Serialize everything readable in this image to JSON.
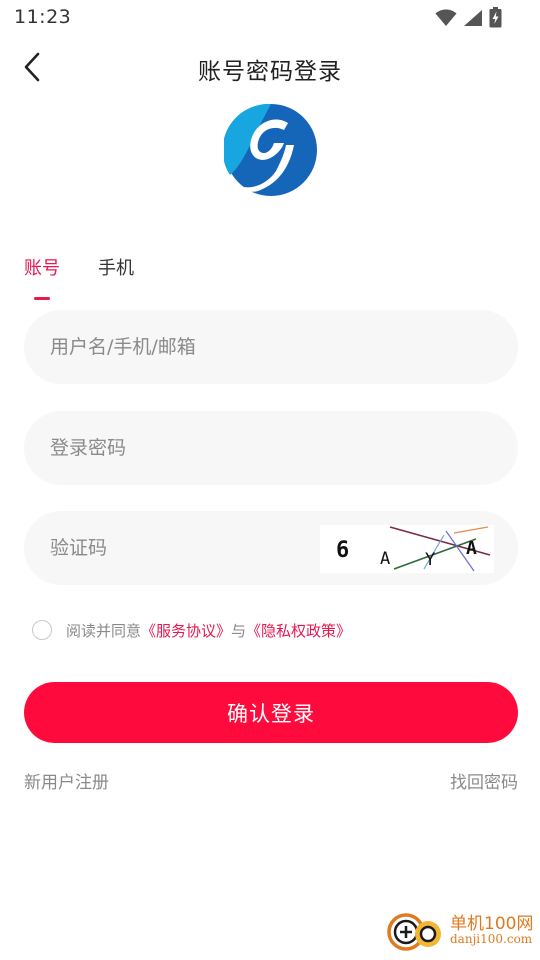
{
  "status_bar": {
    "time": "11:23",
    "icons": [
      "wifi-icon",
      "cell-signal-icon",
      "battery-charging-icon"
    ]
  },
  "header": {
    "title": "账号密码登录",
    "back_icon": "chevron-left-icon"
  },
  "logo": {
    "icon": "app-logo-icon",
    "colors": {
      "outer": "#1565b8",
      "inner": "#18a6e0",
      "letter": "#ffffff"
    }
  },
  "tabs": [
    {
      "label": "账号",
      "active": true
    },
    {
      "label": "手机",
      "active": false
    }
  ],
  "form": {
    "username_placeholder": "用户名/手机/邮箱",
    "username_value": "",
    "password_placeholder": "登录密码",
    "password_value": "",
    "captcha_placeholder": "验证码",
    "captcha_value": "",
    "captcha_image_text": "6 A Y A"
  },
  "agreement": {
    "prefix": "阅读并同意",
    "service_link": "《服务协议》",
    "conjunction": "与",
    "privacy_link": "《隐私权政策》",
    "checked": false
  },
  "submit_label": "确认登录",
  "footer": {
    "register_label": "新用户注册",
    "forgot_label": "找回密码"
  },
  "watermark": {
    "brand": "单机100网",
    "site": "danji100.com"
  },
  "colors": {
    "accent": "#e8174f",
    "button": "#ff0a3c",
    "field_bg": "#f7f7f7",
    "muted_text": "#8a8a8a"
  }
}
